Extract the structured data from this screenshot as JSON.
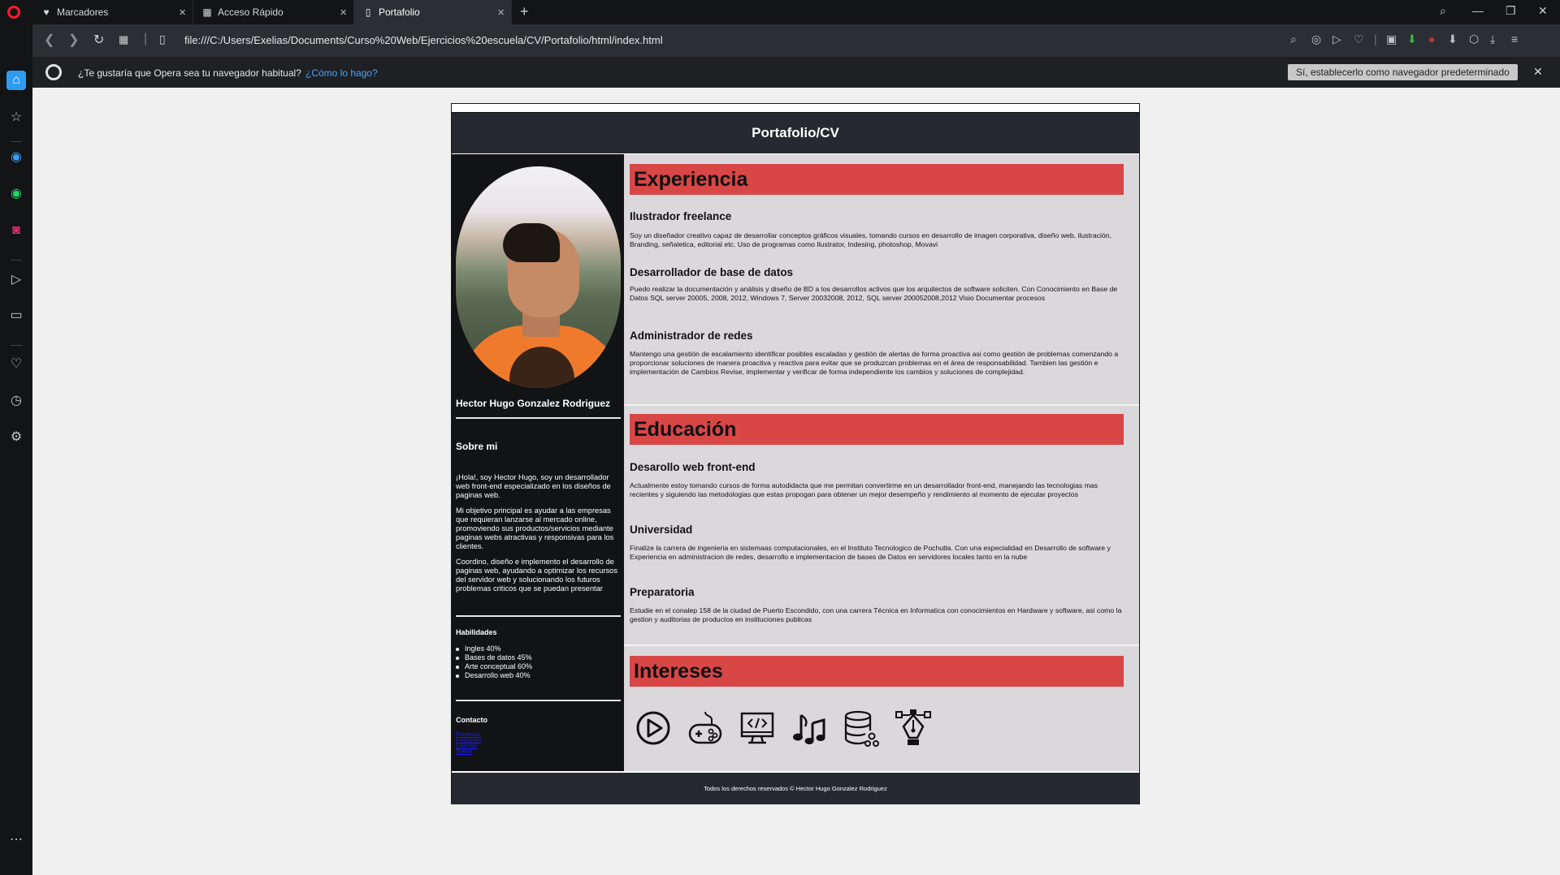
{
  "browser": {
    "tabs": [
      {
        "label": "Marcadores",
        "icon": "heart-icon"
      },
      {
        "label": "Acceso Rápido",
        "icon": "grid-icon"
      },
      {
        "label": "Portafolio",
        "icon": "page-icon"
      }
    ],
    "url": "file:///C:/Users/Exelias/Documents/Curso%20Web/Ejercicios%20escuela/CV/Portafolio/html/index.html",
    "infobar": {
      "question": "¿Te gustaría que Opera sea tu navegador habitual?",
      "link": "¿Cómo lo hago?",
      "button": "Sí, establecerlo como navegador predeterminado"
    }
  },
  "page": {
    "header": "Portafolio/CV",
    "name": "Hector Hugo Gonzalez Rodriguez",
    "sobre": {
      "title": "Sobre mi",
      "p1": "¡Hola!, soy Hector Hugo, soy un desarrollador web front-end especializado en los diseños de paginas web.",
      "p2": "Mi objetivo principal es ayudar a las empresas que requieran lanzarse al mercado online, promoviendo sus productos/servicios mediante paginas webs atractivas y responsivas para los clientes.",
      "p3": "Coordino, diseño e implemento el desarrollo de paginas web, ayudando a optimizar los recursos del servidor web y solucionando los futuros problemas criticos que se puedan presentar"
    },
    "habilidades": {
      "title": "Habilidades",
      "items": [
        "Ingles 40%",
        "Bases de datos 45%",
        "Arte conceptual 60%",
        "Desarrollo web 40%"
      ]
    },
    "contacto": {
      "title": "Contacto",
      "links": [
        "Facebook",
        "Instagram",
        "Linkedin",
        "Twitter"
      ]
    },
    "experiencia": {
      "title": "Experiencia",
      "items": [
        {
          "title": "Ilustrador freelance",
          "text": "Soy un diseñador creativo capaz de desarrollar conceptos gráficos visuales, tomando cursos en desarrollo de imagen corporativa, diseño web, ilustración, Branding, señaletica, editorial etc. Uso de programas como Ilustrator, Indesing, photoshop, Movavi"
        },
        {
          "title": "Desarrollador de base de datos",
          "text": "Puedo realizar la documentación y análisis y diseño de BD a los desarrollos activos que los arquitectos de software soliciten. Con Conocimiento en Base de Datos SQL server 20005, 2008, 2012, Windows 7, Server 20032008, 2012, SQL server 200052008,2012 Visio Documentar procesos"
        },
        {
          "title": "Administrador de redes",
          "text": "Mantengo una gestión de escalamiento identificar posibles escaladas y gestión de alertas de forma proactiva asi como gestión de problemas comenzando a proporcionar soluciones de manera proactiva y reactiva para evitar que se produzcan problemas en el área de responsabilidad. Tambien las gestión e implementación de Cambios Revise, implementar y verificar de forma independiente los cambios y soluciones de complejidad."
        }
      ]
    },
    "educacion": {
      "title": "Educación",
      "items": [
        {
          "title": "Desarollo web front-end",
          "text": "Actualmente estoy tomando cursos de forma autodidacta que me permitan convertirme en un desarrollador front-end, manejando las tecnologias mas recientes y siguiendo las metodologias que estas propogan para obtener un mejor desempeño y rendimiento al momento de ejecutar proyectos"
        },
        {
          "title": "Universidad",
          "text": "Finalize la carrera de ingenieria en sistemaas computacionales, en el Instituto Tecnologico de Pochutla. Con una especialidad en Desarrollo de software y Experiencia en administracion de redes, desarrollo e implementacion de bases de Datos en servidores locales tanto en la nube"
        },
        {
          "title": "Preparatoria",
          "text": "Estudie en el conalep 158 de la ciudad de Puerto Escondido, con una carrera Técnica en Informatica con conocimientos en Hardware y software, asi como la gestion y auditorias de productos en instituciones publicas"
        }
      ]
    },
    "intereses": {
      "title": "Intereses",
      "icons": [
        "play-icon",
        "gamepad-icon",
        "code-monitor-icon",
        "music-note-icon",
        "database-icon",
        "pen-tool-icon"
      ]
    },
    "footer": "Todos los derechos reservados © Hector Hugo Gonzalez Rodriguez"
  },
  "colors": {
    "accent_red": "#d84646",
    "dark": "#262a30",
    "panel": "#dbd8dc",
    "opera_red": "#ff1b2d"
  }
}
